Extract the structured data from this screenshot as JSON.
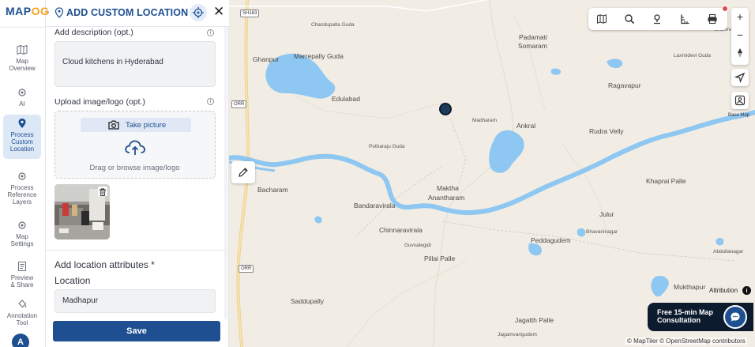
{
  "brand": {
    "logo_prefix": "MAP",
    "logo_suffix": "OG"
  },
  "rail": {
    "items": [
      {
        "label_1": "Map",
        "label_2": "Overview",
        "label_3": ""
      },
      {
        "label_1": "AI",
        "label_2": "",
        "label_3": ""
      },
      {
        "label_1": "Process",
        "label_2": "Custom",
        "label_3": "Location"
      },
      {
        "label_1": "Process",
        "label_2": "Reference",
        "label_3": "Layers"
      },
      {
        "label_1": "Map",
        "label_2": "Settings",
        "label_3": ""
      },
      {
        "label_1": "Preview",
        "label_2": "& Share",
        "label_3": ""
      },
      {
        "label_1": "Annotation",
        "label_2": "Tool",
        "label_3": ""
      }
    ],
    "avatar_initial": "A"
  },
  "panel": {
    "title": "ADD CUSTOM LOCATION",
    "description_label": "Add description (opt.)",
    "description_value": "Cloud kitchens in Hyderabad",
    "upload_label": "Upload image/logo (opt.)",
    "take_picture": "Take picture",
    "drag_text": "Drag or browse image/logo",
    "attributes_title": "Add location attributes *",
    "location_label": "Location",
    "location_value": "Madhapur",
    "save_label": "Save"
  },
  "map": {
    "places": [
      {
        "id": "chandupatla",
        "name": "Chandupatla Guda"
      },
      {
        "id": "padamati",
        "name": "Padamati"
      },
      {
        "id": "somaram",
        "name": "Somaram"
      },
      {
        "id": "ghanpur",
        "name": "Ghanpur"
      },
      {
        "id": "marrepally",
        "name": "Marrepally Guda"
      },
      {
        "id": "laxmidevi",
        "name": "Laxmidevi Guda"
      },
      {
        "id": "edulabad",
        "name": "Edulabad"
      },
      {
        "id": "ragavapur",
        "name": "Ragavapur"
      },
      {
        "id": "madharam",
        "name": "Madharam"
      },
      {
        "id": "ankral",
        "name": "Ankral"
      },
      {
        "id": "rudravelly",
        "name": "Rudra Velly"
      },
      {
        "id": "potharaju",
        "name": "Potharaju Guda"
      },
      {
        "id": "bacharam",
        "name": "Bacharam"
      },
      {
        "id": "khapraipalle",
        "name": "Khaprai Palle"
      },
      {
        "id": "maktha",
        "name": "Maktha"
      },
      {
        "id": "anantharam",
        "name": "Anantharam"
      },
      {
        "id": "bandaravirala",
        "name": "Bandaravirala"
      },
      {
        "id": "julur",
        "name": "Julur"
      },
      {
        "id": "chinnaravirala",
        "name": "Chinnaravirala"
      },
      {
        "id": "bhavaninagar",
        "name": "Bhavaninagar"
      },
      {
        "id": "guvvalegidi",
        "name": "Guvvalegidi"
      },
      {
        "id": "peddagudem",
        "name": "Peddagudem"
      },
      {
        "id": "pillaipalle",
        "name": "Pillai Palle"
      },
      {
        "id": "abdullanagar",
        "name": "Abdullanagar"
      },
      {
        "id": "saddupally",
        "name": "Saddupally"
      },
      {
        "id": "mukthapur",
        "name": "Mukthapur"
      },
      {
        "id": "jagatthpalle",
        "name": "Jagatth Palle"
      },
      {
        "id": "jagamvarigudem",
        "name": "Jagamvarigudem"
      },
      {
        "id": "brahmana",
        "name": "Brahmana"
      }
    ],
    "shields": [
      "SH163",
      "ORR",
      "ORR"
    ],
    "base_map_label": "Base Map",
    "attribution_label": "Attribution",
    "consult_line1": "Free 15-min Map",
    "consult_line2": "Consultation",
    "copyright": "© MapTiler © OpenStreetMap contributors"
  },
  "colors": {
    "brand": "#1e4f91",
    "accent": "#f2a51c",
    "water": "#8ec7f2",
    "land": "#f2ede4"
  }
}
